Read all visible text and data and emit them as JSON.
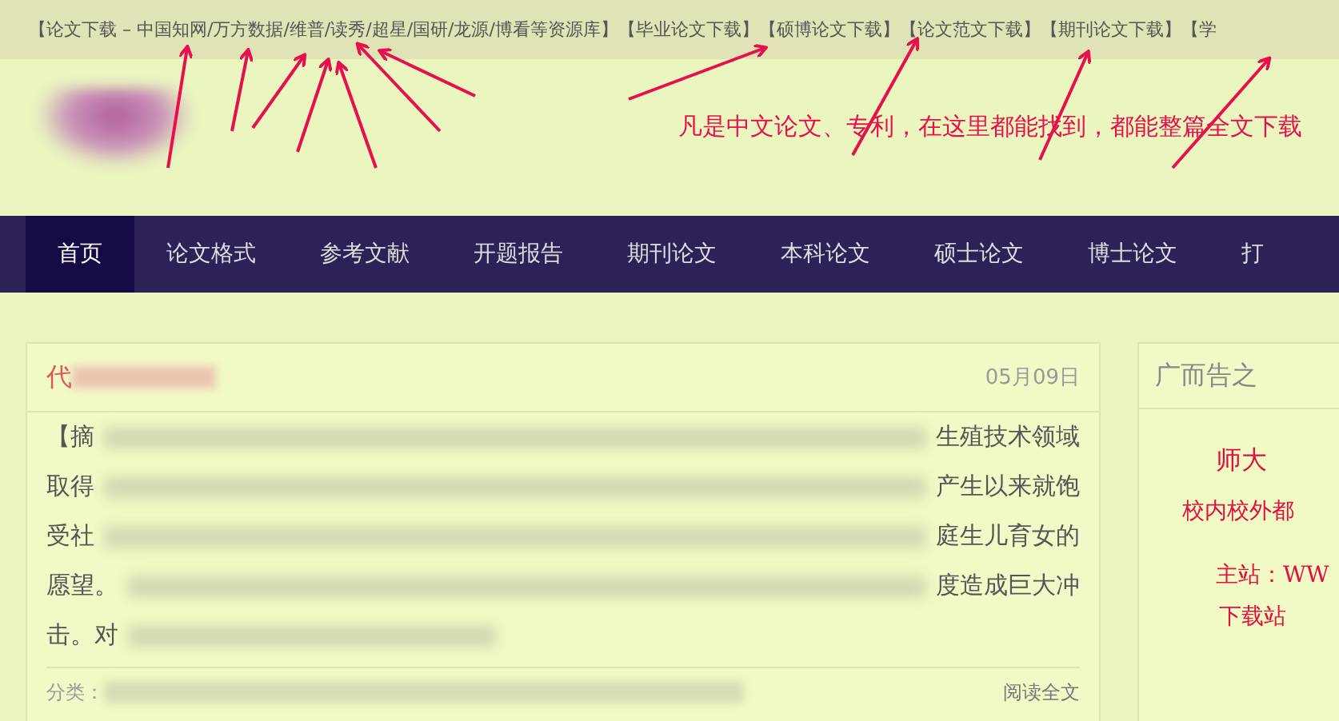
{
  "top_links": [
    "【论文下载 – 中国知网/万方数据/维普/读秀/超星/国研/龙源/博看等资源库】",
    "【毕业论文下载】",
    "【硕博论文下载】",
    "【论文范文下载】",
    "【期刊论文下载】",
    "【学"
  ],
  "annotation": "凡是中文论文、专利，在这里都能找到，都能整篇全文下载",
  "nav": [
    {
      "label": "首页",
      "selected": true
    },
    {
      "label": "论文格式",
      "selected": false
    },
    {
      "label": "参考文献",
      "selected": false
    },
    {
      "label": "开题报告",
      "selected": false
    },
    {
      "label": "期刊论文",
      "selected": false
    },
    {
      "label": "本科论文",
      "selected": false
    },
    {
      "label": "硕士论文",
      "selected": false
    },
    {
      "label": "博士论文",
      "selected": false
    },
    {
      "label": "打",
      "selected": false
    }
  ],
  "article": {
    "title_start": "代",
    "date": "05月09日",
    "lines": [
      {
        "left": "【摘",
        "right": "生殖技术领域"
      },
      {
        "left": "取得",
        "right": "产生以来就饱"
      },
      {
        "left": "受社",
        "right": "庭生儿育女的"
      },
      {
        "left": "愿望。",
        "right": "度造成巨大冲"
      },
      {
        "left": "击。对"
      }
    ],
    "meta_start": "分类：",
    "read_more": "阅读全文"
  },
  "sidebar": {
    "title": "广而告之",
    "ad_lines": [
      "师大",
      "校内校外都",
      "主站：WW",
      "下载站"
    ]
  }
}
